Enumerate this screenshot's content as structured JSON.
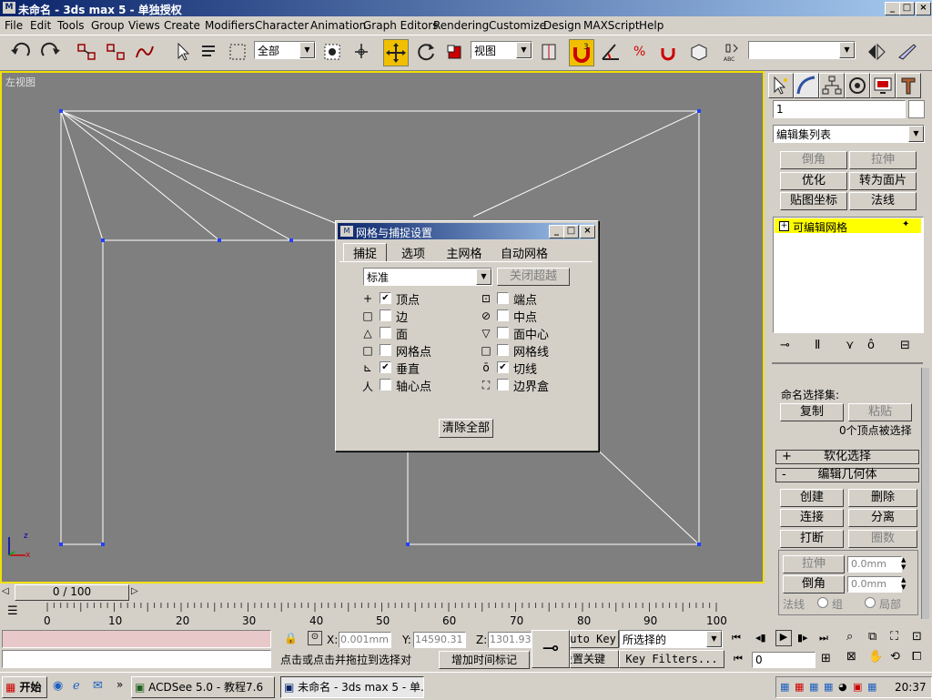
{
  "window": {
    "title": "未命名 - 3ds max 5 - 单独授权"
  },
  "menu": [
    "File",
    "Edit",
    "Tools",
    "Group",
    "Views",
    "Create",
    "Modifiers",
    "Character",
    "Animation",
    "Graph Editors",
    "Rendering",
    "Customize",
    "Design",
    "MAXScript",
    "Help"
  ],
  "toolbar": {
    "selection_filter": "全部",
    "ref_coord": "视图",
    "named_selection": ""
  },
  "viewport": {
    "label": "左视图",
    "axis_x": "x",
    "axis_z": "z"
  },
  "dialog": {
    "title": "网格与捕捉设置",
    "tabs": [
      "捕捉",
      "选项",
      "主网格",
      "自动网格"
    ],
    "preset": "标准",
    "override_button": "关闭超越",
    "left_snaps": [
      {
        "label": "顶点",
        "checked": true,
        "icon": "+"
      },
      {
        "label": "边",
        "checked": false,
        "icon": "□"
      },
      {
        "label": "面",
        "checked": false,
        "icon": "△"
      },
      {
        "label": "网格点",
        "checked": false,
        "icon": "□"
      },
      {
        "label": "垂直",
        "checked": true,
        "icon": "⊾"
      },
      {
        "label": "轴心点",
        "checked": false,
        "icon": "人"
      }
    ],
    "right_snaps": [
      {
        "label": "端点",
        "checked": false,
        "icon": "⊡"
      },
      {
        "label": "中点",
        "checked": false,
        "icon": "⊘"
      },
      {
        "label": "面中心",
        "checked": false,
        "icon": "▽"
      },
      {
        "label": "网格线",
        "checked": false,
        "icon": "□"
      },
      {
        "label": "切线",
        "checked": true,
        "icon": "ō"
      },
      {
        "label": "边界盒",
        "checked": false,
        "icon": "⛶"
      }
    ],
    "clear_all": "清除全部"
  },
  "panel": {
    "object_name": "1",
    "modifier_list": "编辑集列表",
    "btn_chamfer_top": "倒角",
    "btn_extrude_top": "拉伸",
    "btn_optimize": "优化",
    "btn_to_patch": "转为面片",
    "btn_uv": "贴图坐标",
    "btn_normal": "法线",
    "stack_item": "可编辑网格",
    "named_sel": "命名选择集:",
    "btn_copy": "复制",
    "btn_paste": "粘贴",
    "sel_status": "0个顶点被选择",
    "rollout_soft": "软化选择",
    "rollout_soft_sign": "+",
    "rollout_edit": "编辑几何体",
    "rollout_edit_sign": "-",
    "btn_create": "创建",
    "btn_delete": "删除",
    "btn_attach": "连接",
    "btn_detach": "分离",
    "btn_break": "打断",
    "btn_turn": "圈数",
    "btn_extrude": "拉伸",
    "btn_chamfer": "倒角",
    "spin_extrude": "0.0mm",
    "spin_chamfer": "0.0mm",
    "normal_label": "法线",
    "radio_group": "组",
    "radio_local": "局部"
  },
  "timeline": {
    "frame_display": "0 / 100",
    "ticks": [
      "0",
      "10",
      "20",
      "30",
      "40",
      "50",
      "60",
      "70",
      "80",
      "90",
      "100"
    ]
  },
  "status": {
    "x_label": "X:",
    "x_value": "0.001mm",
    "y_label": "Y:",
    "y_value": "14590.31",
    "z_label": "Z:",
    "z_value": "1301.93",
    "prompt": "点击或点击并拖拉到选择对",
    "add_time_tag": "增加时间标记",
    "auto_key": "Auto Key",
    "set_key": "设置关键",
    "key_mode": "所选择的",
    "key_filters": "Key Filters...",
    "current_frame": "0"
  },
  "taskbar": {
    "start": "开始",
    "task1": "ACDSee 5.0 - 教程7.6",
    "task2": "未命名 - 3ds max 5 - 单...",
    "clock": "20:37"
  },
  "colors": {
    "viewport_bg": "#7f7f7f",
    "viewport_border": "#f0e000",
    "stack_highlight": "#ffff00",
    "accent": "#0a246a"
  }
}
